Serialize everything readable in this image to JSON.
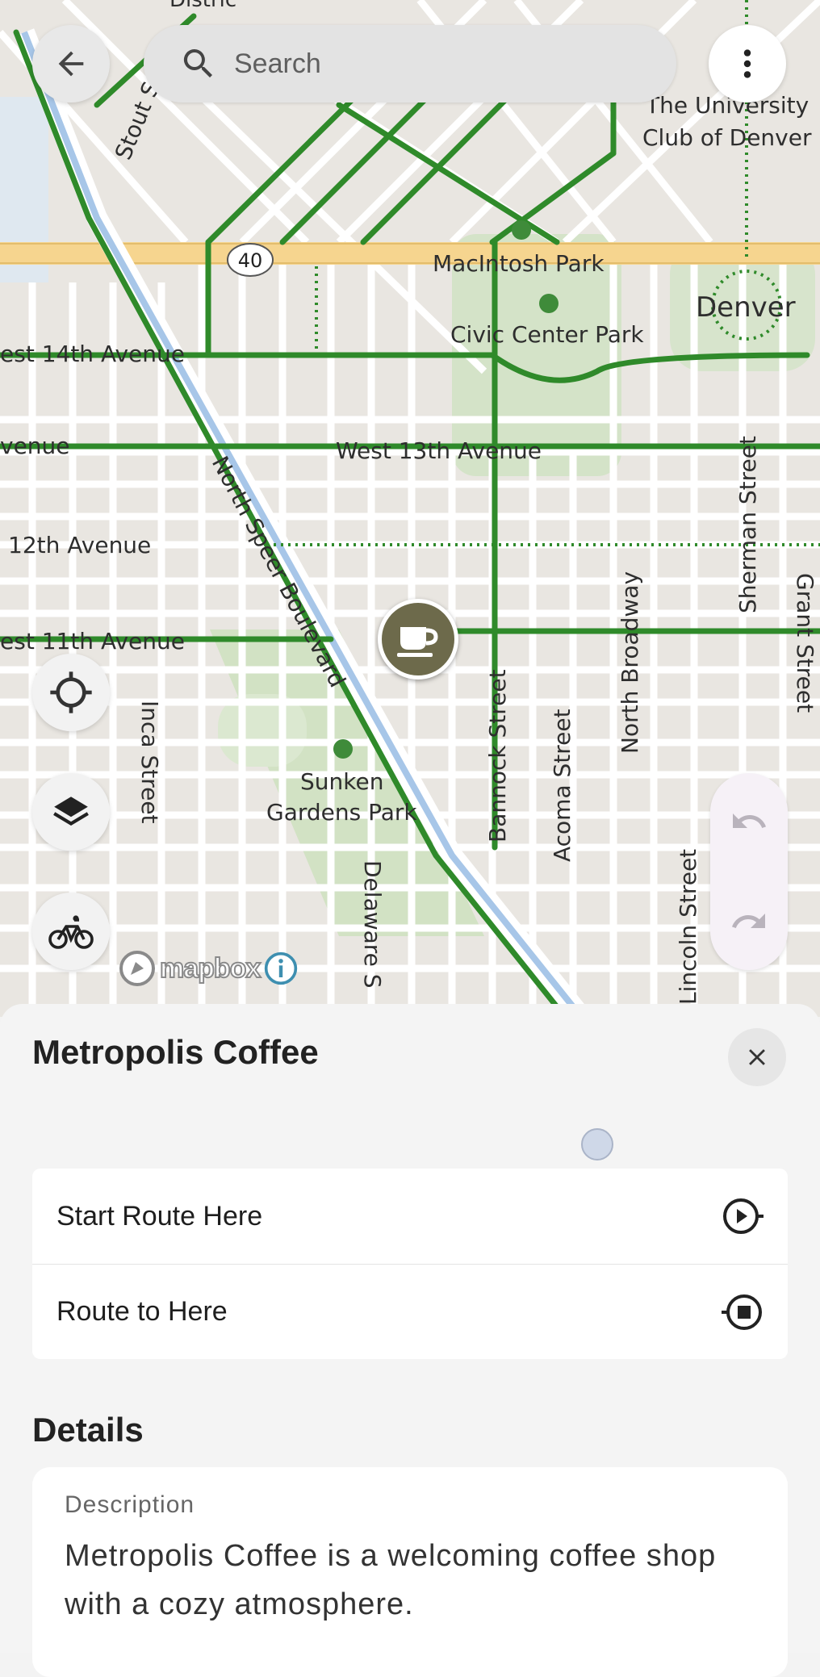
{
  "search": {
    "placeholder": "Search"
  },
  "map": {
    "labels": {
      "university": "The University",
      "university2": "Club of Denver",
      "macintosh": "MacIntosh Park",
      "denver": "Denver",
      "civic": "Civic Center Park",
      "west14": "est 14th Avenue",
      "west13": "West 13th Avenue",
      "venue": "venue",
      "twelfth": "12th Avenue",
      "west11": "est 11th Avenue",
      "speer": "North Speer Boulevard",
      "sherman": "Sherman Street",
      "grant": "Grant Street",
      "broadway": "North Broadway",
      "bannock": "Bannock Street",
      "acoma": "Acoma Street",
      "lincoln": "Lincoln Street",
      "inca": "Inca Street",
      "delaware": "Delaware S",
      "sunken1": "Sunken",
      "sunken2": "Gardens Park",
      "stout": "Stout S",
      "highway": "40",
      "district": "Distric"
    },
    "attribution": "mapbox"
  },
  "sheet": {
    "title": "Metropolis Coffee",
    "actions": [
      {
        "label": "Start Route Here",
        "icon": "route-start-icon"
      },
      {
        "label": "Route to Here",
        "icon": "route-end-icon"
      }
    ],
    "details_heading": "Details",
    "description_label": "Description",
    "description": "Metropolis Coffee is a welcoming coffee shop with a cozy atmosphere."
  },
  "colors": {
    "bike_route": "#2f8a2a",
    "highway": "#f6d58f",
    "water": "#a7c6e8",
    "park": "#cddfc3",
    "poi_pin": "#6d6a4b"
  }
}
